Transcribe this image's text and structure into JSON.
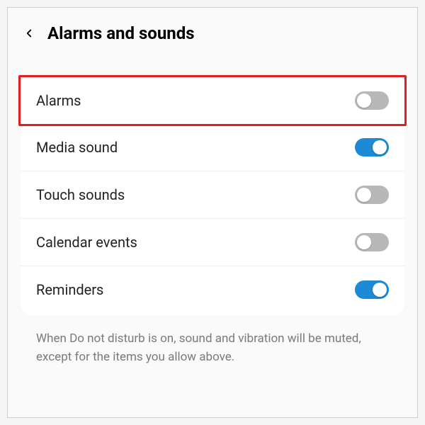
{
  "header": {
    "title": "Alarms and sounds"
  },
  "items": [
    {
      "label": "Alarms",
      "enabled": false,
      "highlight": true
    },
    {
      "label": "Media sound",
      "enabled": true,
      "highlight": false
    },
    {
      "label": "Touch sounds",
      "enabled": false,
      "highlight": false
    },
    {
      "label": "Calendar events",
      "enabled": false,
      "highlight": false
    },
    {
      "label": "Reminders",
      "enabled": true,
      "highlight": false
    }
  ],
  "footer": "When Do not disturb is on, sound and vibration will be muted, except for the items you allow above."
}
